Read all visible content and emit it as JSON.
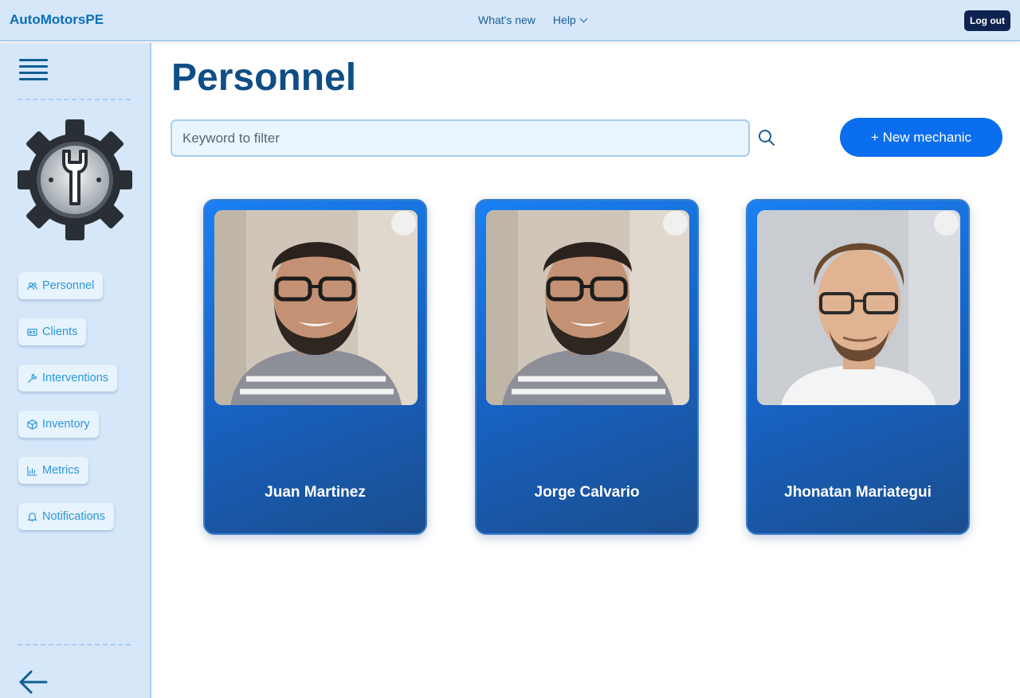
{
  "header": {
    "brand": "AutoMotorsPE",
    "nav": [
      "What's new",
      "Help"
    ],
    "logout_label": "Log out"
  },
  "sidebar": {
    "items": [
      {
        "label": "Personnel",
        "icon": "users-icon"
      },
      {
        "label": "Clients",
        "icon": "id-card-icon"
      },
      {
        "label": "Interventions",
        "icon": "wrench-icon"
      },
      {
        "label": "Inventory",
        "icon": "box-icon"
      },
      {
        "label": "Metrics",
        "icon": "bar-chart-icon"
      },
      {
        "label": "Notifications",
        "icon": "bell-icon"
      }
    ]
  },
  "main": {
    "title": "Personnel",
    "search_placeholder": "Keyword to filter",
    "new_button_label": "+ New mechanic"
  },
  "mechanics": [
    {
      "name": "Juan Martinez"
    },
    {
      "name": "Jorge Calvario"
    },
    {
      "name": "Jhonatan Mariategui"
    }
  ],
  "colors": {
    "accent": "#0a6eef",
    "card_top": "#1a80f2",
    "card_bottom": "#1a4d8e",
    "title": "#0e4e86",
    "sidebar_bg": "#d6e7fa"
  }
}
